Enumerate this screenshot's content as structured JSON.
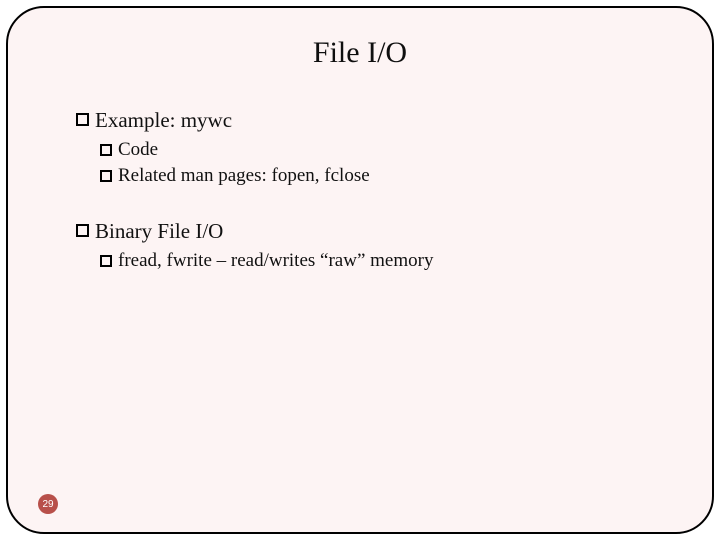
{
  "title": "File I/O",
  "items": [
    {
      "level": 1,
      "text": "Example: mywc"
    },
    {
      "level": 2,
      "text": "Code"
    },
    {
      "level": 2,
      "text": "Related man pages: fopen, fclose"
    },
    {
      "level": 0,
      "gap": true
    },
    {
      "level": 1,
      "text": "Binary File I/O"
    },
    {
      "level": 2,
      "text": "fread, fwrite – read/writes “raw” memory"
    }
  ],
  "page_number": "29"
}
